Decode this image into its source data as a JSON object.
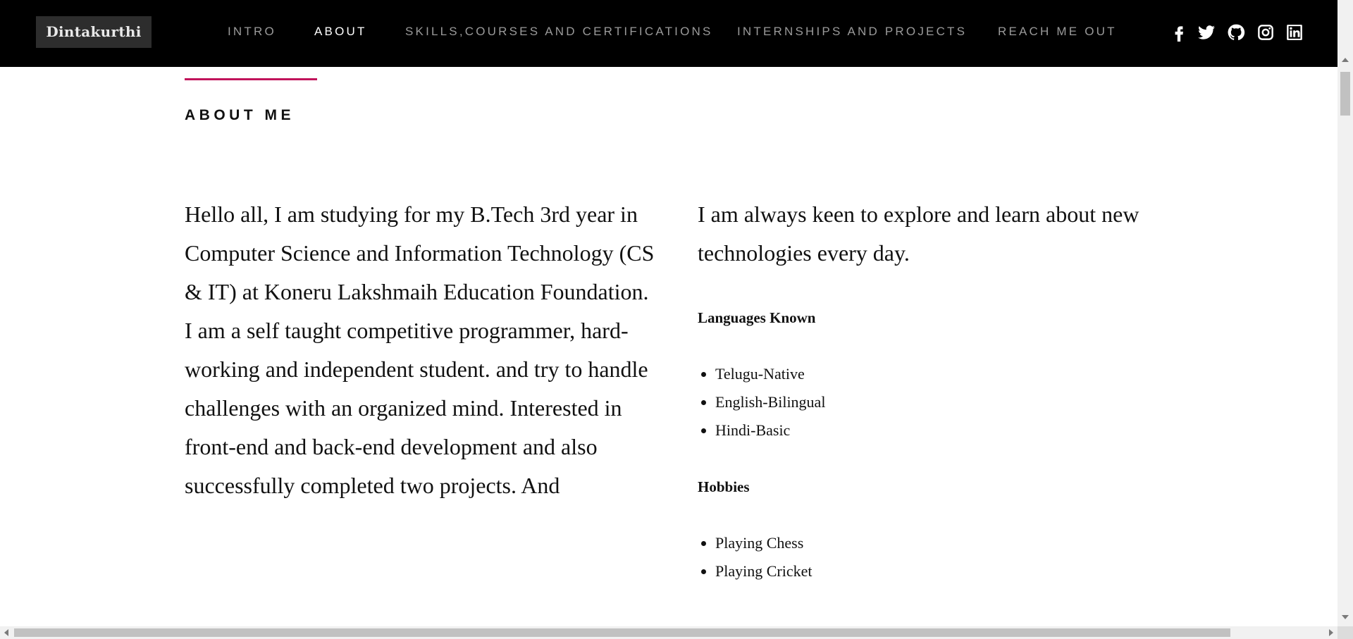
{
  "brand": {
    "name": "Dintakurthi"
  },
  "nav": {
    "items": [
      {
        "label": "INTRO",
        "active": false
      },
      {
        "label": "ABOUT",
        "active": true
      },
      {
        "label": "SKILLS,COURSES AND CERTIFICATIONS",
        "active": false
      },
      {
        "label": "INTERNSHIPS AND PROJECTS",
        "active": false
      },
      {
        "label": "REACH ME OUT",
        "active": false
      }
    ]
  },
  "socials": [
    {
      "icon": "facebook-icon"
    },
    {
      "icon": "twitter-icon"
    },
    {
      "icon": "github-icon"
    },
    {
      "icon": "instagram-icon"
    },
    {
      "icon": "linkedin-icon"
    }
  ],
  "colors": {
    "accent": "#c1135b",
    "navbar": "#000000",
    "brand_bg": "#2d2d2d"
  },
  "about": {
    "title": "ABOUT ME",
    "left_text": "Hello all, I am studying for my B.Tech 3rd year in Computer Science and Information Technology (CS & IT) at Koneru Lakshmaih Education Foundation. I am a self taught competitive programmer, hard-working and independent student. and try to handle challenges with an organized mind. Interested in front-end and back-end development and also successfully completed two projects. And",
    "right_text": "I am always keen to explore and learn about new technologies every day.",
    "languages_heading": "Languages Known",
    "languages": [
      "Telugu-Native",
      "English-Bilingual",
      "Hindi-Basic"
    ],
    "hobbies_heading": "Hobbies",
    "hobbies": [
      "Playing Chess",
      "Playing Cricket"
    ]
  }
}
